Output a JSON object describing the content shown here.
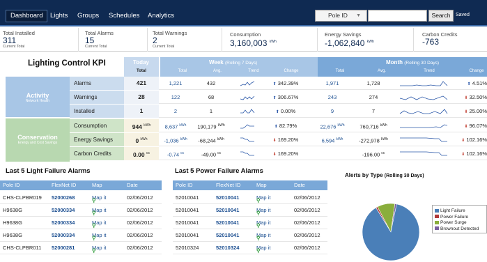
{
  "nav": {
    "tabs": [
      "Dashboard",
      "Lights",
      "Groups",
      "Schedules",
      "Analytics"
    ],
    "select_value": "Pole ID",
    "search_label": "Search",
    "saved_label": "Saved"
  },
  "summary": [
    {
      "label": "Total Installed",
      "value": "311",
      "sub": "Current Total",
      "unit": ""
    },
    {
      "label": "Total Alarms",
      "value": "15",
      "sub": "Current Total",
      "unit": ""
    },
    {
      "label": "Total Warnings",
      "value": "2",
      "sub": "Current Total",
      "unit": ""
    },
    {
      "label": "Consumption",
      "value": "3,160,003",
      "sub": "",
      "unit": "kWh"
    },
    {
      "label": "Energy Savings",
      "value": "-1,062,840",
      "sub": "",
      "unit": "kWh"
    },
    {
      "label": "Carbon Credits",
      "value": "-763",
      "sub": "",
      "unit": ""
    }
  ],
  "kpi": {
    "title": "Lighting Control KPI",
    "today_label": "Today",
    "today_sub": "Total",
    "week_label": "Week",
    "week_note": "(Rolling 7 Days)",
    "month_label": "Month",
    "month_note": "(Rolling 30 Days)",
    "week_cols": [
      "Total",
      "Avg.",
      "Trend",
      "Change"
    ],
    "month_cols": [
      "Total",
      "Avg.",
      "Trend",
      "Change"
    ],
    "groups": [
      {
        "name": "Activity",
        "sub": "Network Health"
      },
      {
        "name": "Conservation",
        "sub": "Energy and Cost Savings"
      }
    ],
    "rows": [
      {
        "name": "Alarms",
        "today": "421",
        "today_unit": "",
        "wk_total": "1,221",
        "wk_total_unit": "",
        "wk_avg": "432",
        "wk_avg_unit": "",
        "wk_change": "342.39%",
        "wk_dir": "up",
        "mo_total": "1,971",
        "mo_total_unit": "",
        "mo_avg": "1,728",
        "mo_avg_unit": "",
        "mo_change": "4.51%",
        "mo_dir": "up"
      },
      {
        "name": "Warnings",
        "today": "28",
        "today_unit": "",
        "wk_total": "122",
        "wk_total_unit": "",
        "wk_avg": "68",
        "wk_avg_unit": "",
        "wk_change": "306.67%",
        "wk_dir": "up",
        "mo_total": "243",
        "mo_total_unit": "",
        "mo_avg": "274",
        "mo_avg_unit": "",
        "mo_change": "32.50%",
        "mo_dir": "down"
      },
      {
        "name": "Installed",
        "today": "1",
        "today_unit": "",
        "wk_total": "2",
        "wk_total_unit": "",
        "wk_avg": "1",
        "wk_avg_unit": "",
        "wk_change": "0.00%",
        "wk_dir": "up",
        "mo_total": "9",
        "mo_total_unit": "",
        "mo_avg": "7",
        "mo_avg_unit": "",
        "mo_change": "25.00%",
        "mo_dir": "down"
      },
      {
        "name": "Consumption",
        "today": "944",
        "today_unit": "kWh",
        "wk_total": "8,637",
        "wk_total_unit": "kWh",
        "wk_avg": "190,179",
        "wk_avg_unit": "kWh",
        "wk_change": "82.79%",
        "wk_dir": "up",
        "mo_total": "22,676",
        "mo_total_unit": "kWh",
        "mo_avg": "760,716",
        "mo_avg_unit": "kWh",
        "mo_change": "96.07%",
        "mo_dir": "down"
      },
      {
        "name": "Energy Savings",
        "today": "0",
        "today_unit": "kWh",
        "wk_total": "-1,036",
        "wk_total_unit": "kWh",
        "wk_avg": "-68,244",
        "wk_avg_unit": "kWh",
        "wk_change": "169.20%",
        "wk_dir": "down",
        "mo_total": "6,594",
        "mo_total_unit": "kWh",
        "mo_avg": "-272,978",
        "mo_avg_unit": "kWh",
        "mo_change": "102.16%",
        "mo_dir": "down"
      },
      {
        "name": "Carbon Credits",
        "today": "0.00",
        "today_unit": "cc",
        "wk_total": "-0.74",
        "wk_total_unit": "cc",
        "wk_avg": "-49.00",
        "wk_avg_unit": "cc",
        "wk_change": "169.20%",
        "wk_dir": "down",
        "mo_total": "",
        "mo_total_unit": "",
        "mo_avg": "-196.00",
        "mo_avg_unit": "cc",
        "mo_change": "102.16%",
        "mo_dir": "down"
      }
    ]
  },
  "light_alarms": {
    "title": "Last 5 Light Failure Alarms",
    "headers": [
      "Pole ID",
      "FlexNet ID",
      "Map",
      "Date"
    ],
    "map_label": "Map it",
    "rows": [
      {
        "pole": "CHS-CLPBR019",
        "flexnet": "52000268",
        "date": "02/06/2012"
      },
      {
        "pole": "H9638G",
        "flexnet": "52000334",
        "date": "02/06/2012"
      },
      {
        "pole": "H9638G",
        "flexnet": "52000334",
        "date": "02/06/2012"
      },
      {
        "pole": "H9638G",
        "flexnet": "52000334",
        "date": "02/06/2012"
      },
      {
        "pole": "CHS-CLPBR011",
        "flexnet": "52000281",
        "date": "02/06/2012"
      }
    ]
  },
  "power_alarms": {
    "title": "Last 5 Power Failure Alarms",
    "headers": [
      "Pole ID",
      "FlexNet ID",
      "Map",
      "Date"
    ],
    "map_label": "Map it",
    "rows": [
      {
        "pole": "52010041",
        "flexnet": "52010041",
        "date": "02/06/2012"
      },
      {
        "pole": "52010041",
        "flexnet": "52010041",
        "date": "02/06/2012"
      },
      {
        "pole": "52010041",
        "flexnet": "52010041",
        "date": "02/06/2012"
      },
      {
        "pole": "52010041",
        "flexnet": "52010041",
        "date": "02/06/2012"
      },
      {
        "pole": "52010324",
        "flexnet": "52010324",
        "date": "02/06/2012"
      }
    ]
  },
  "alerts_chart": {
    "title": "Alerts by Type",
    "title_note": "(Rolling 30 Days)"
  },
  "chart_data": {
    "type": "pie",
    "title": "Alerts by Type (Rolling 30 Days)",
    "categories": [
      "Light Failure",
      "Power Failure",
      "Power Surge",
      "Brownout Detected"
    ],
    "values": [
      88,
      1,
      10,
      1
    ],
    "colors": [
      "#4a7fb8",
      "#b23a3a",
      "#8aae3c",
      "#7a5fa0"
    ],
    "legend": "top-right"
  }
}
